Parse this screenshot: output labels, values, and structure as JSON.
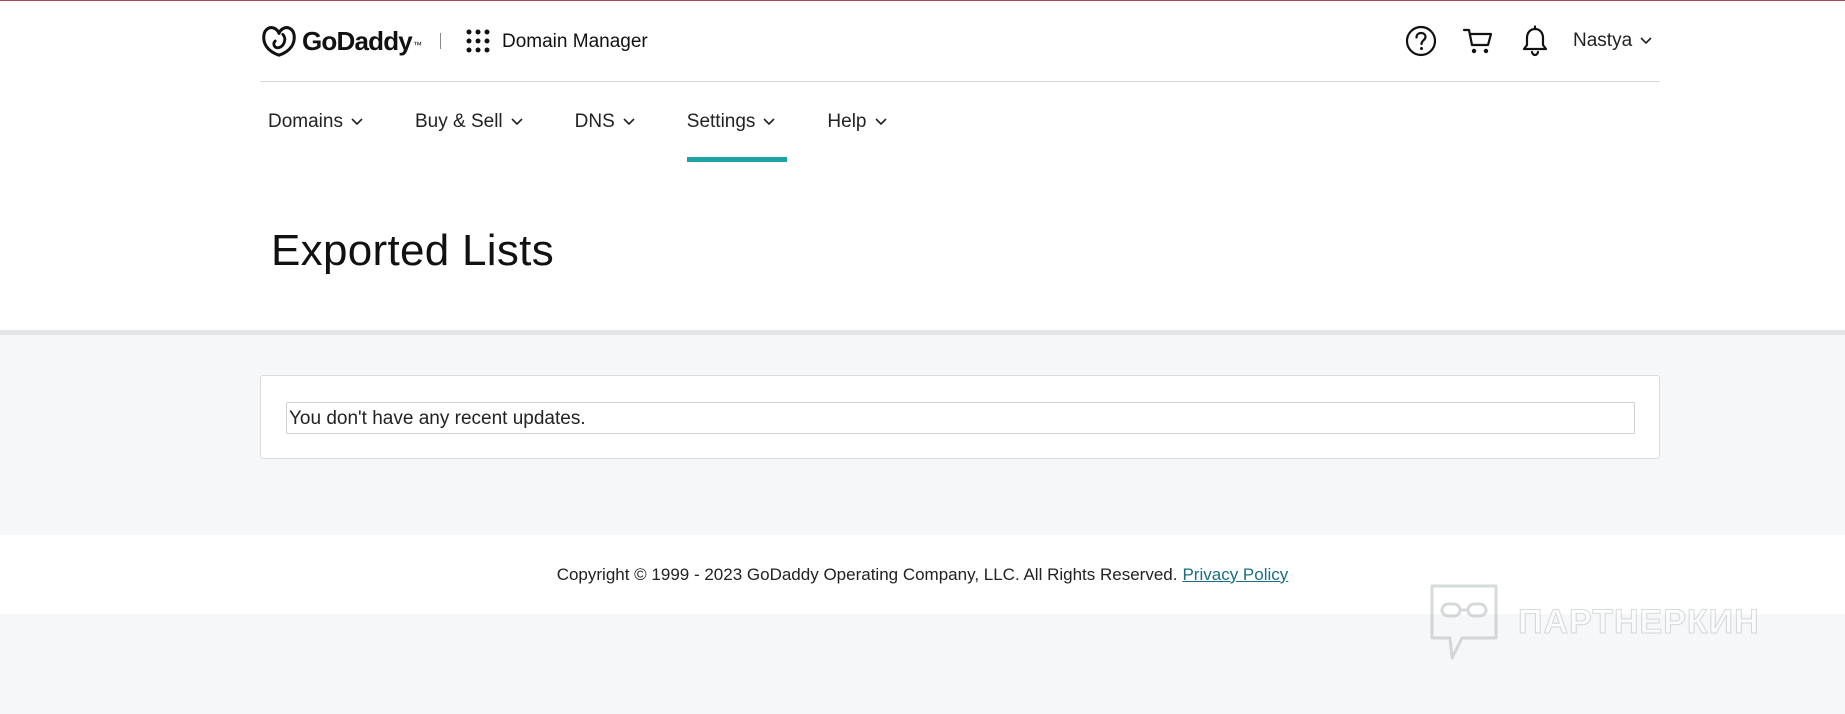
{
  "header": {
    "brand": "GoDaddy",
    "app_title": "Domain Manager",
    "user_name": "Nastya"
  },
  "nav": [
    {
      "label": "Domains"
    },
    {
      "label": "Buy & Sell"
    },
    {
      "label": "DNS"
    },
    {
      "label": "Settings",
      "active": true
    },
    {
      "label": "Help"
    }
  ],
  "page": {
    "title": "Exported Lists",
    "empty_message": "You don't have any recent updates."
  },
  "footer": {
    "copyright": "Copyright © 1999 - 2023 GoDaddy Operating Company, LLC. All Rights Reserved.",
    "privacy_link": "Privacy Policy"
  },
  "watermark": {
    "text": "ПАРТНЕРКИН"
  },
  "icons": {
    "logo": "godaddy-logo-icon",
    "apps": "grid-icon",
    "help": "help-icon",
    "cart": "cart-icon",
    "notifications": "bell-icon"
  },
  "colors": {
    "accent": "#1ba3a6",
    "link": "#1b6d86",
    "page_bg": "#f5f7f8"
  }
}
